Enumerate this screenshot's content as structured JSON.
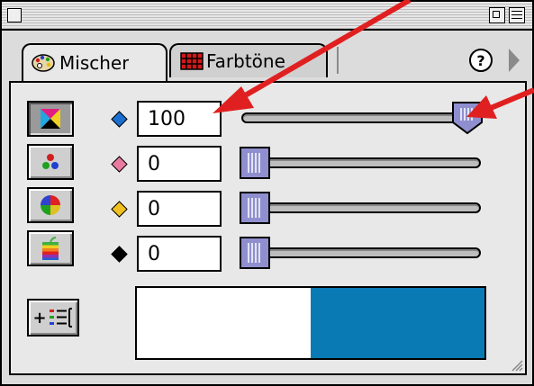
{
  "window": {
    "tabs": [
      {
        "label": "Mischer",
        "icon": "palette-icon",
        "active": true
      },
      {
        "label": "Farbtöne",
        "icon": "color-grid-icon",
        "active": false
      }
    ],
    "help_label": "?"
  },
  "modes": [
    {
      "name": "cmyk-mode",
      "icon": "cmyk-icon",
      "active": true
    },
    {
      "name": "rgb-mode",
      "icon": "rgb-dots-icon",
      "active": false
    },
    {
      "name": "hsb-mode",
      "icon": "color-wheel-icon",
      "active": false
    },
    {
      "name": "apple-picker-mode",
      "icon": "apple-rainbow-icon",
      "active": false
    }
  ],
  "channels": [
    {
      "name": "cyan",
      "color": "#1a6fd0",
      "value": "100",
      "level": 1.0
    },
    {
      "name": "magenta",
      "color": "#e87aa0",
      "value": "0",
      "level": 0.0
    },
    {
      "name": "yellow",
      "color": "#f0c020",
      "value": "0",
      "level": 0.0
    },
    {
      "name": "black",
      "color": "#000000",
      "value": "0",
      "level": 0.0
    }
  ],
  "add_button_label": "+",
  "swatch": {
    "previous_color": "#ffffff",
    "current_color": "#0a7ab5"
  },
  "colors": {
    "window_bg": "#dcdcdc",
    "panel_bg": "#e8e8e8",
    "thumb": "#8f8fd0",
    "annotation_arrow": "#e02020"
  }
}
